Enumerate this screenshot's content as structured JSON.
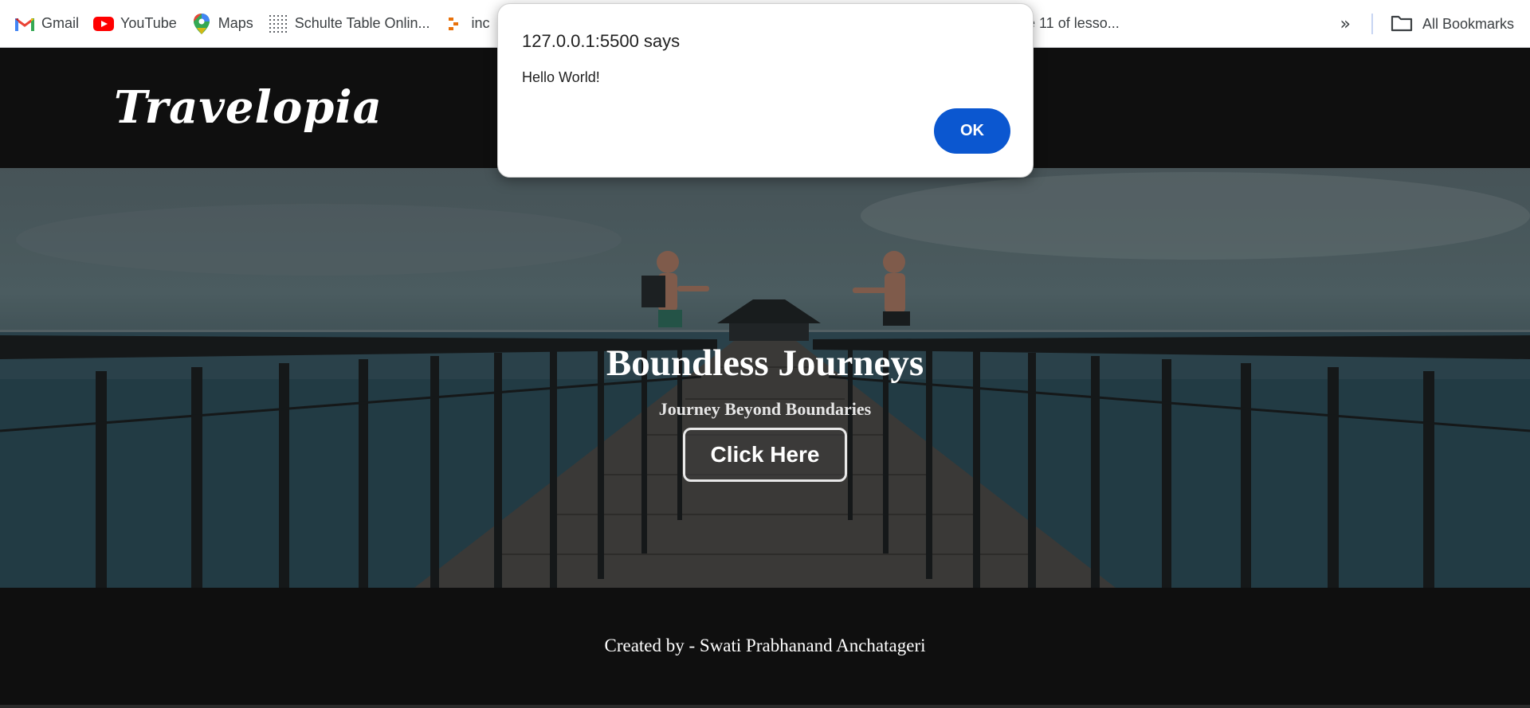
{
  "bookmarks": {
    "items": [
      {
        "label": "Gmail",
        "icon": "gmail-icon"
      },
      {
        "label": "YouTube",
        "icon": "youtube-icon"
      },
      {
        "label": "Maps",
        "icon": "maps-pin-icon"
      },
      {
        "label": "Schulte Table Onlin...",
        "icon": "grid-icon"
      },
      {
        "label": "inc",
        "icon": "bookmark-app-icon"
      },
      {
        "label": "se 11 of lesso...",
        "icon": ""
      }
    ],
    "more_label": "»",
    "all_bookmarks": "All Bookmarks"
  },
  "site": {
    "logo": "Travelopia"
  },
  "hero": {
    "title": "Boundless Journeys",
    "subtitle": "Journey Beyond Boundaries",
    "button_label": "Click Here"
  },
  "footer": {
    "text": "Created by - Swati Prabhanand Anchatageri"
  },
  "dialog": {
    "title": "127.0.0.1:5500 says",
    "message": "Hello World!",
    "ok_label": "OK"
  },
  "colors": {
    "header_bg": "#0f0f0f",
    "ok_button": "#0b57d0",
    "bookmark_text": "#3c4043"
  }
}
